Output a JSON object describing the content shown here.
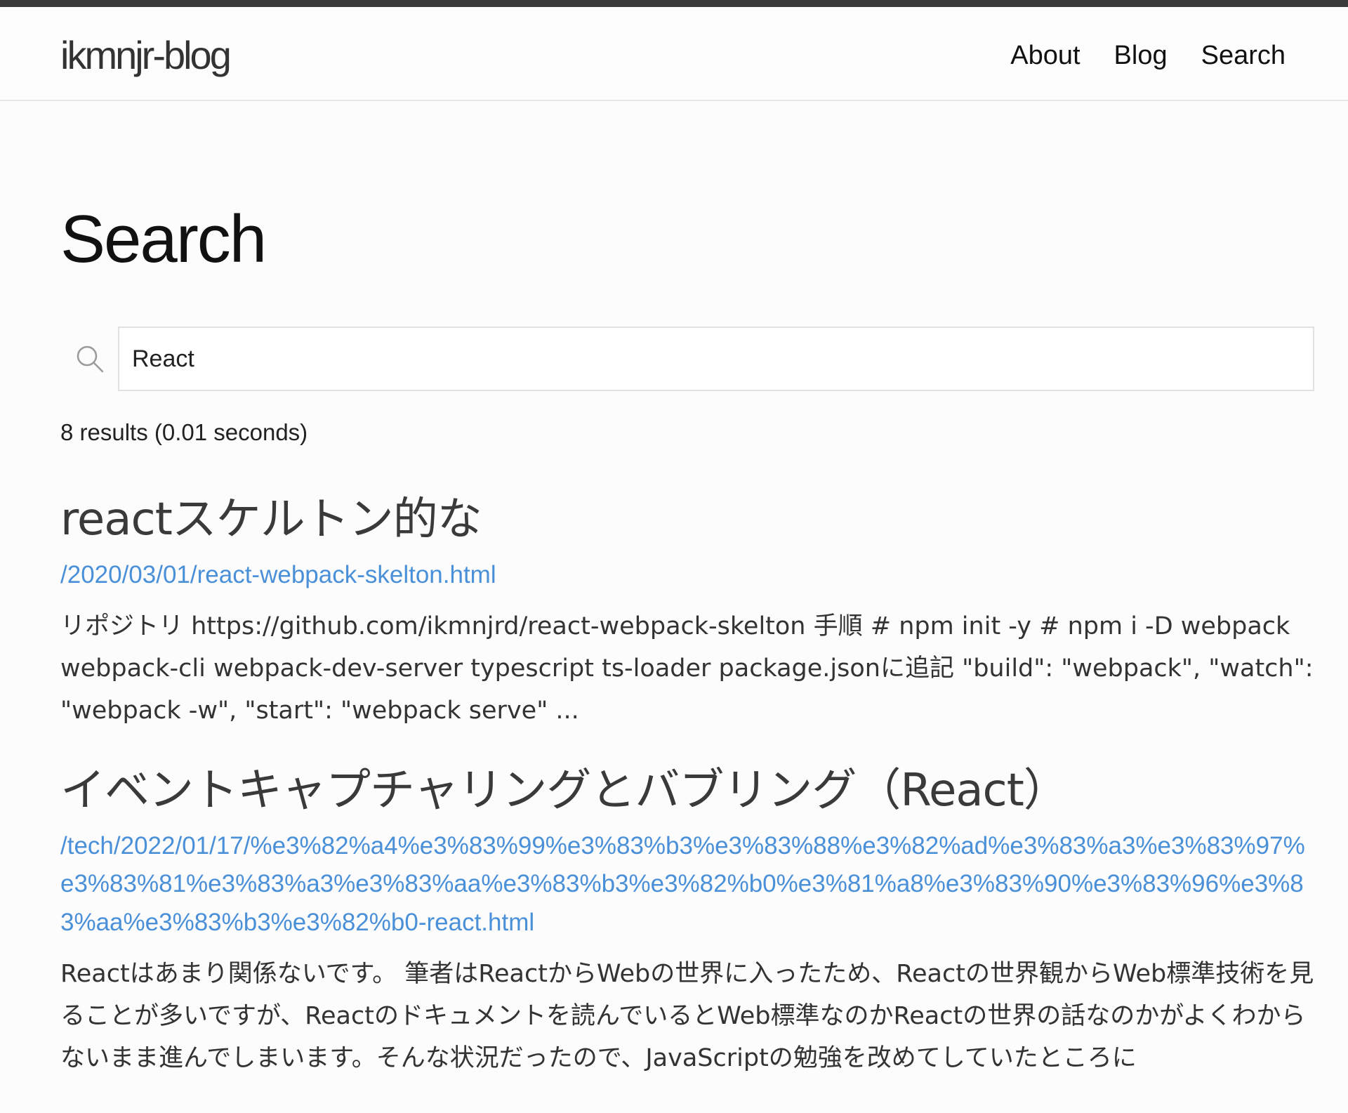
{
  "header": {
    "site_title": "ikmnjr-blog",
    "nav": [
      {
        "label": "About"
      },
      {
        "label": "Blog"
      },
      {
        "label": "Search"
      }
    ]
  },
  "page": {
    "title": "Search"
  },
  "search": {
    "value": "React",
    "result_count_text": "8 results (0.01 seconds)"
  },
  "results": [
    {
      "title": "reactスケルトン的な",
      "url": "/2020/03/01/react-webpack-skelton.html",
      "snippet": "リポジトリ https://github.com/ikmnjrd/react-webpack-skelton 手順 # npm init -y # npm i -D webpack webpack-cli webpack-dev-server typescript ts-loader package.jsonに追記 \"build\": \"webpack\", \"watch\": \"webpack -w\", \"start\": \"webpack serve\" ..."
    },
    {
      "title": "イベントキャプチャリングとバブリング（React）",
      "url": "/tech/2022/01/17/%e3%82%a4%e3%83%99%e3%83%b3%e3%83%88%e3%82%ad%e3%83%a3%e3%83%97%e3%83%81%e3%83%a3%e3%83%aa%e3%83%b3%e3%82%b0%e3%81%a8%e3%83%90%e3%83%96%e3%83%aa%e3%83%b3%e3%82%b0-react.html",
      "snippet": "Reactはあまり関係ないです。 筆者はReactからWebの世界に入ったため、Reactの世界観からWeb標準技術を見ることが多いですが、Reactのドキュメントを読んでいるとWeb標準なのかReactの世界の話なのかがよくわからないまま進んでしまいます。そんな状況だったので、JavaScriptの勉強を改めてしていたところに"
    }
  ],
  "colors": {
    "link": "#4a90d9",
    "top_strip": "#3a3a3a",
    "border": "#e2e2e2"
  },
  "icons": {
    "search": "search-icon"
  }
}
